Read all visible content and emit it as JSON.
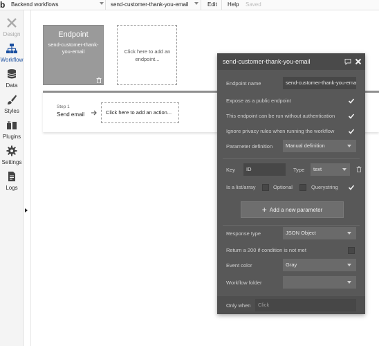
{
  "topbar": {
    "logo": "b",
    "app_page": "Backend workflows",
    "workflow": "send-customer-thank-you-email",
    "edit": "Edit",
    "help": "Help",
    "saved": "Saved"
  },
  "sidebar": {
    "items": [
      {
        "label": "Design",
        "icon": "design-icon"
      },
      {
        "label": "Workflow",
        "icon": "workflow-icon"
      },
      {
        "label": "Data",
        "icon": "data-icon"
      },
      {
        "label": "Styles",
        "icon": "styles-icon"
      },
      {
        "label": "Plugins",
        "icon": "plugins-icon"
      },
      {
        "label": "Settings",
        "icon": "settings-icon"
      },
      {
        "label": "Logs",
        "icon": "logs-icon"
      }
    ]
  },
  "canvas": {
    "endpoint_title": "Endpoint",
    "endpoint_name": "send-customer-thank-you-email",
    "add_endpoint": "Click here to add an endpoint...",
    "step_label": "Step 1",
    "step_name": "Send email",
    "add_action": "Click here to add an action..."
  },
  "panel": {
    "title": "send-customer-thank-you-email",
    "endpoint_name_label": "Endpoint name",
    "endpoint_name_value": "send-customer-thank-you-email",
    "expose_label": "Expose as a public endpoint",
    "expose_checked": true,
    "no_auth_label": "This endpoint can be run without authentication",
    "no_auth_checked": true,
    "ignore_privacy_label": "Ignore privacy rules when running the workflow",
    "ignore_privacy_checked": true,
    "param_def_label": "Parameter definition",
    "param_def_value": "Manual definition",
    "key_label": "Key",
    "key_value": "ID",
    "type_label": "Type",
    "type_value": "text",
    "is_list_label": "Is a list/array",
    "is_list_checked": false,
    "optional_label": "Optional",
    "optional_checked": false,
    "querystring_label": "Querystring",
    "querystring_checked": true,
    "add_param_label": "Add a new parameter",
    "response_type_label": "Response type",
    "response_type_value": "JSON Object",
    "return_200_label": "Return a 200 if condition is not met",
    "return_200_checked": false,
    "event_color_label": "Event color",
    "event_color_value": "Gray",
    "workflow_folder_label": "Workflow folder",
    "workflow_folder_value": "",
    "only_when_label": "Only when",
    "only_when_placeholder": "Click"
  },
  "colors": {
    "panel_bg": "#585858",
    "panel_header": "#4a4a4a",
    "field_bg": "#474747",
    "endpoint_card": "#9a9a9a",
    "active_nav": "#1a4fa0"
  }
}
